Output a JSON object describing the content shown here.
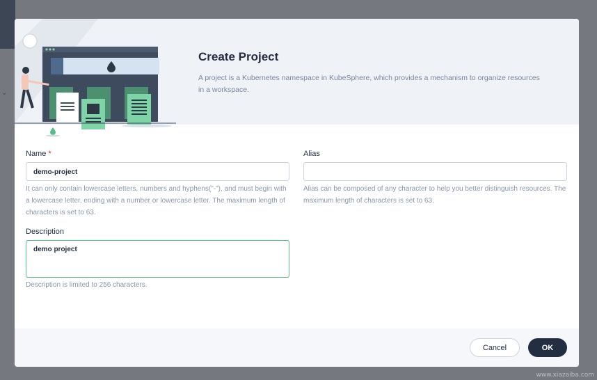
{
  "modal": {
    "title": "Create Project",
    "subtitle": "A project is a Kubernetes namespace in KubeSphere, which provides a mechanism to organize resources in a workspace."
  },
  "form": {
    "name": {
      "label": "Name",
      "required_mark": "*",
      "value": "demo-project",
      "help": "It can only contain lowercase letters, numbers and hyphens(\"-\"), and must begin with a lowercase letter, ending with a number or lowercase letter. The maximum length of characters is set to 63."
    },
    "alias": {
      "label": "Alias",
      "value": "",
      "help": "Alias can be composed of any character to help you better distinguish resources. The maximum length of characters is set to 63."
    },
    "description": {
      "label": "Description",
      "value": "demo project",
      "help": "Description is limited to 256 characters."
    }
  },
  "footer": {
    "cancel_label": "Cancel",
    "ok_label": "OK"
  },
  "watermark": "www.xiazaiba.com",
  "colors": {
    "accent_green": "#55bc8a",
    "primary_dark": "#242e42",
    "required_red": "#ca2621",
    "header_bg": "#eff2f7"
  },
  "icons": [
    "droplet-icon",
    "document-icon",
    "chevron-down-icon"
  ]
}
